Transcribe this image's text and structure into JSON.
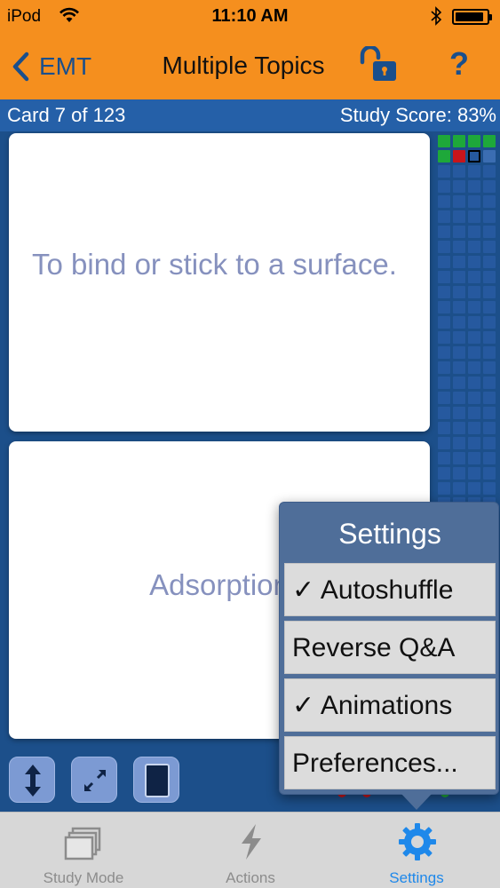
{
  "status_bar": {
    "carrier": "iPod",
    "time": "11:10 AM"
  },
  "nav": {
    "back_label": "EMT",
    "title": "Multiple Topics",
    "help_label": "?"
  },
  "info": {
    "card_count": "Card 7 of 123",
    "study_score": "Study Score: 83%"
  },
  "question_card": {
    "text": "To bind or stick to a surface."
  },
  "answer_card": {
    "text": "Adsorption"
  },
  "progress_grid": {
    "columns": 4,
    "rows": 34,
    "cell_colors": {
      "green": "#1ea83a",
      "red": "#c8151b",
      "pending": "#3b6db2",
      "empty": "#26599f"
    },
    "first_row": [
      "green",
      "green",
      "green",
      "green"
    ],
    "second_row": [
      "green",
      "red",
      "current",
      "pending"
    ]
  },
  "tools": {
    "flip_icon": "up-down-arrow-icon",
    "expand_icon": "expand-icon",
    "card_icon": "card-icon"
  },
  "settings_popover": {
    "title": "Settings",
    "options": [
      {
        "label": "✓ Autoshuffle",
        "checked": true
      },
      {
        "label": "Reverse Q&A",
        "checked": false
      },
      {
        "label": "✓ Animations",
        "checked": true
      },
      {
        "label": "Preferences...",
        "checked": false
      }
    ]
  },
  "tab_bar": {
    "tabs": [
      {
        "label": "Study Mode",
        "icon": "stacked-cards-icon",
        "active": false
      },
      {
        "label": "Actions",
        "icon": "lightning-icon",
        "active": false
      },
      {
        "label": "Settings",
        "icon": "gear-icon",
        "active": true
      }
    ]
  },
  "colors": {
    "accent_orange": "#f58f1e",
    "nav_blue": "#1a4f8c",
    "background_blue": "#1c4f8a",
    "active_tab": "#1e88ea",
    "card_text": "#8691be"
  }
}
